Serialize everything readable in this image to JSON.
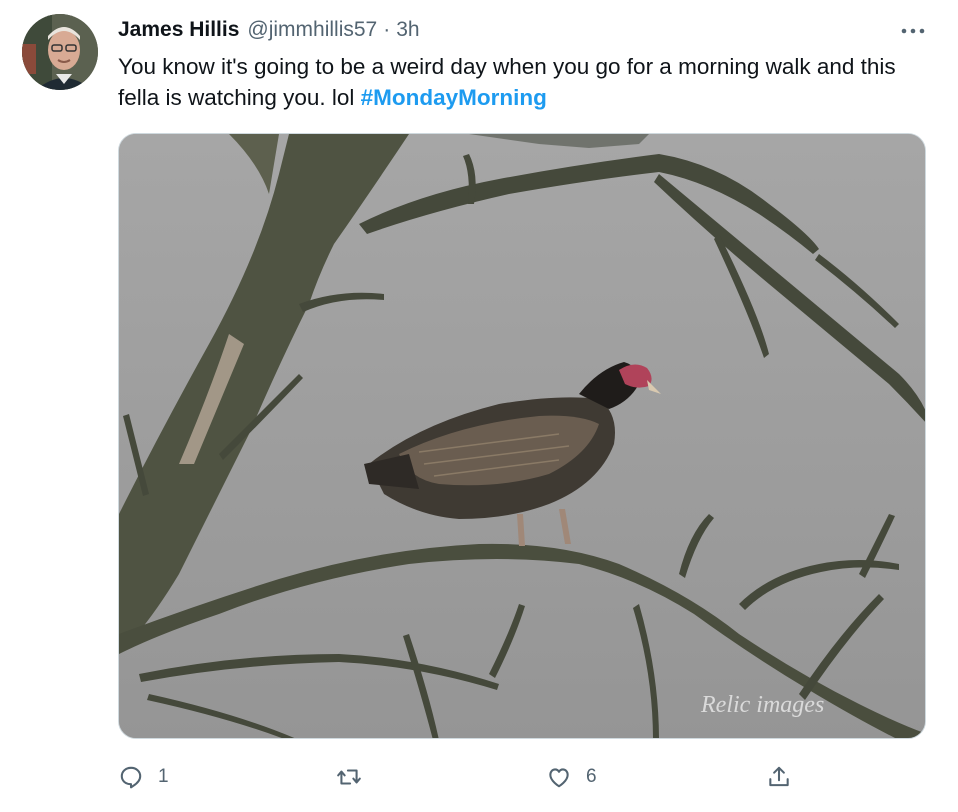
{
  "tweet": {
    "author_name": "James Hillis",
    "author_handle": "@jimmhillis57",
    "separator": "·",
    "time_ago": "3h",
    "text": "You know it's going to be a weird day when you go for a morning walk and this fella is watching you. lol ",
    "hashtag": "#MondayMorning",
    "media_watermark": "Relic images"
  },
  "actions": {
    "reply_count": "1",
    "retweet_count": "",
    "like_count": "6"
  },
  "icons": {
    "more": "more-icon",
    "reply": "reply-icon",
    "retweet": "retweet-icon",
    "like": "like-icon",
    "share": "share-icon"
  },
  "colors": {
    "hashtag": "#1d9bf0",
    "secondary_text": "#536471",
    "primary_text": "#0f1419"
  }
}
